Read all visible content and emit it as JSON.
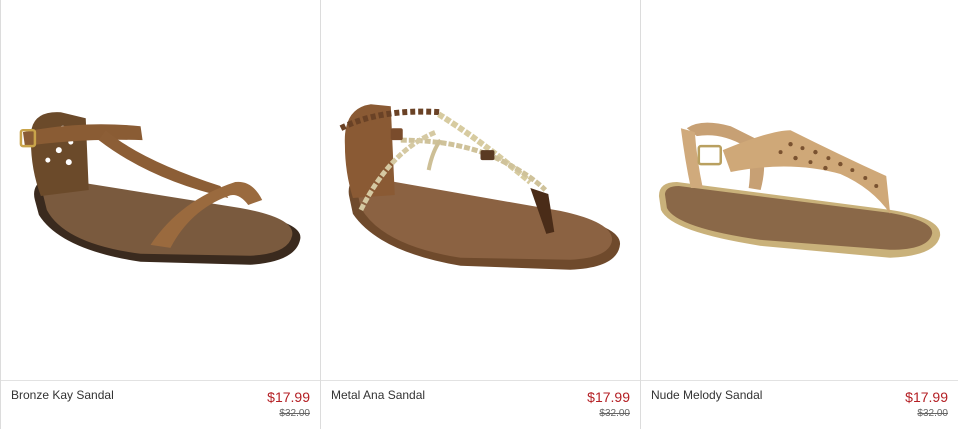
{
  "products": [
    {
      "name": "Bronze Kay Sandal",
      "price": "$17.99",
      "original_price": "$32.00",
      "image": "bronze-t-strap-sandal"
    },
    {
      "name": "Metal Ana Sandal",
      "price": "$17.99",
      "original_price": "$32.00",
      "image": "braided-metallic-thong-sandal"
    },
    {
      "name": "Nude Melody Sandal",
      "price": "$17.99",
      "original_price": "$32.00",
      "image": "nude-laser-cut-thong-sandal"
    }
  ],
  "colors": {
    "sale_price": "#b41f24",
    "original_price": "#666666",
    "divider": "#dcdcdc"
  }
}
